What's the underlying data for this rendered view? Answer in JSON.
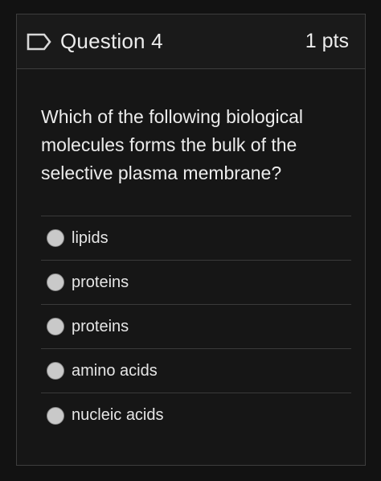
{
  "header": {
    "title": "Question 4",
    "points": "1 pts",
    "flag_icon": "flag-outline-icon"
  },
  "question": {
    "text": "Which of the following biological molecules forms the bulk of the selective plasma membrane?"
  },
  "answers": [
    {
      "label": "lipids"
    },
    {
      "label": "proteins"
    },
    {
      "label": "proteins"
    },
    {
      "label": "amino acids"
    },
    {
      "label": "nucleic acids"
    }
  ]
}
